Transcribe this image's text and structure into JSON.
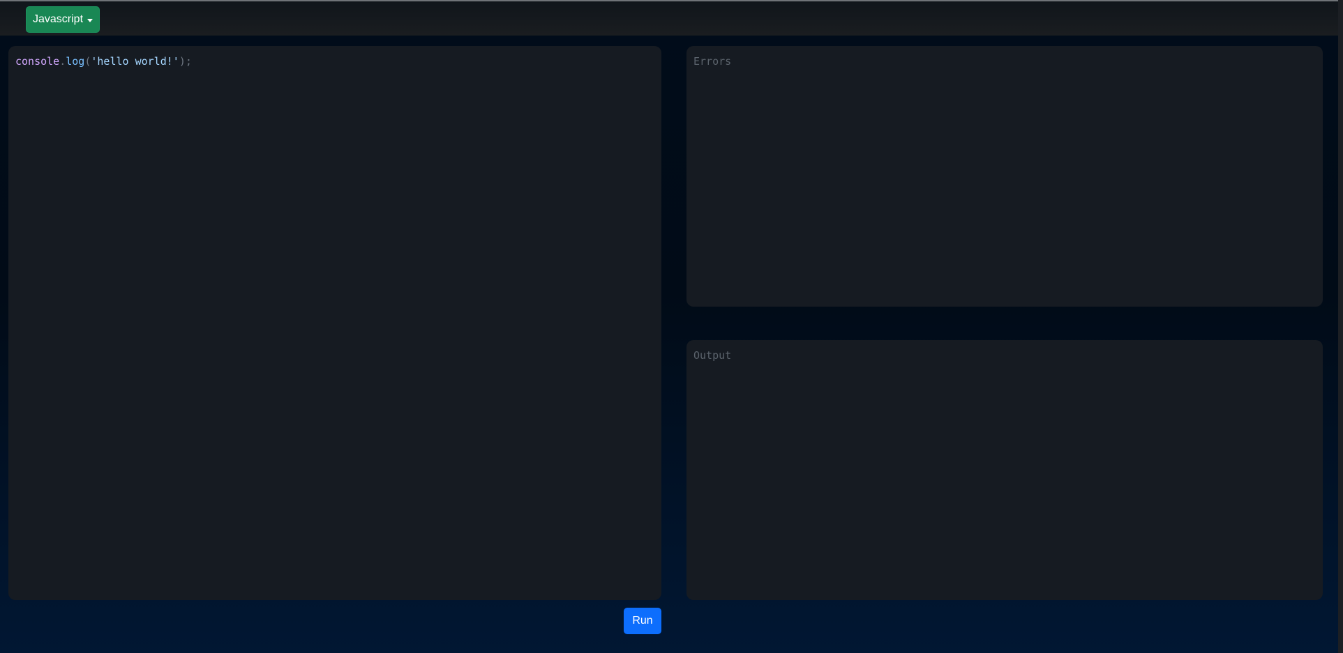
{
  "navbar": {
    "language_label": "Javascript"
  },
  "editor": {
    "code": {
      "object": "console",
      "dot": ".",
      "method": "log",
      "open_paren": "(",
      "string": "'hello world!'",
      "close": ");"
    }
  },
  "errors": {
    "placeholder": "Errors"
  },
  "output": {
    "placeholder": "Output"
  },
  "actions": {
    "run_label": "Run"
  },
  "colors": {
    "dropdown_bg": "#198754",
    "run_bg": "#0d6efd",
    "panel_bg": "#161b22"
  }
}
